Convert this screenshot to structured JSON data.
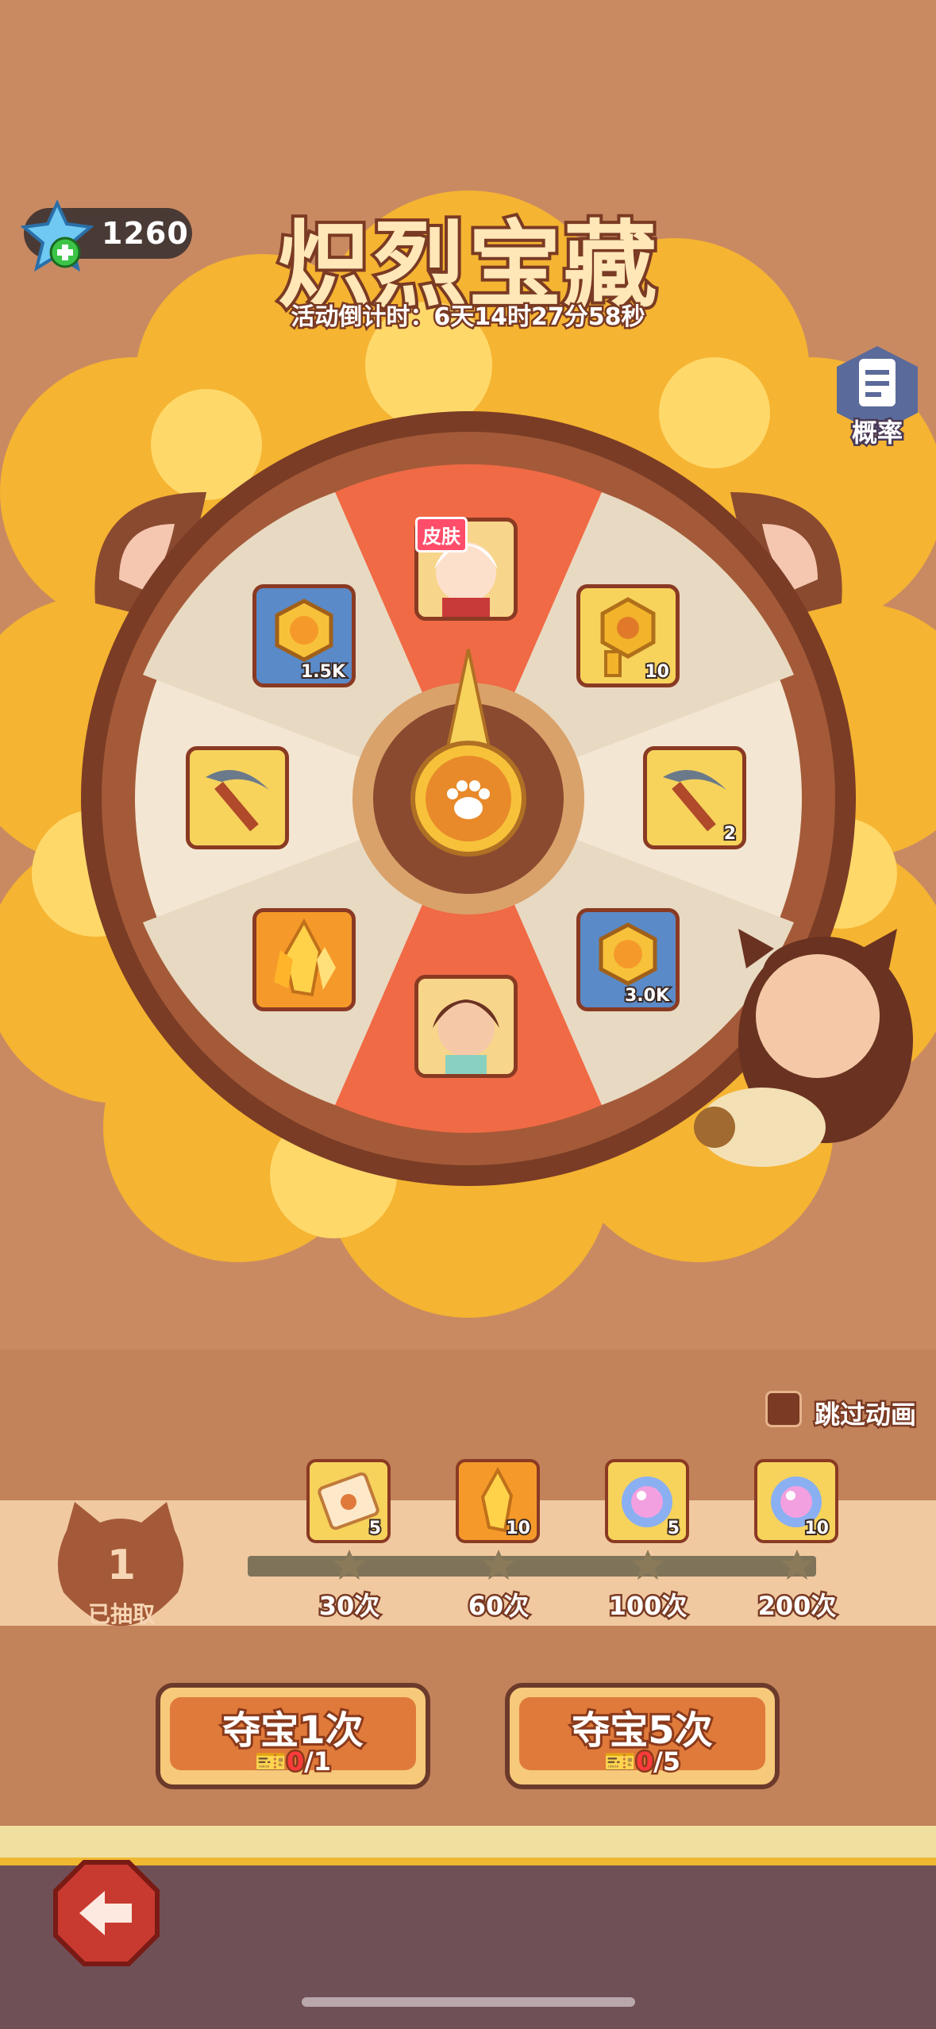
{
  "header": {
    "currency_value": "1260",
    "currency_icon": "blue-gem-plus-icon",
    "title": "炽烈宝藏",
    "countdown": "活动倒计时：6天14时27分58秒",
    "probability_label": "概率"
  },
  "wheel": {
    "center_icon": "paw-icon",
    "items": [
      {
        "name": "skin-character",
        "tag": "皮肤",
        "qty": ""
      },
      {
        "name": "golden-key",
        "qty": "10"
      },
      {
        "name": "pickaxe",
        "qty": "2"
      },
      {
        "name": "gold-coin",
        "qty": "3.0K"
      },
      {
        "name": "character-cat-girl",
        "qty": ""
      },
      {
        "name": "orange-crystal",
        "qty": ""
      },
      {
        "name": "pickaxe",
        "qty": ""
      },
      {
        "name": "gold-coin",
        "qty": "1.5K"
      }
    ]
  },
  "skip_animation_label": "跳过动画",
  "progress": {
    "drawn_count": "1",
    "drawn_label": "已抽取",
    "milestones": [
      {
        "label": "30次",
        "reward": "paw-ticket",
        "qty": "5"
      },
      {
        "label": "60次",
        "reward": "orange-crystal",
        "qty": "10"
      },
      {
        "label": "100次",
        "reward": "pink-pearl",
        "qty": "5"
      },
      {
        "label": "200次",
        "reward": "pink-pearl",
        "qty": "10"
      }
    ]
  },
  "actions": {
    "draw_one": {
      "title": "夺宝1次",
      "cost_have": "0",
      "cost_need": "/1"
    },
    "draw_five": {
      "title": "夺宝5次",
      "cost_have": "0",
      "cost_need": "/5"
    }
  },
  "colors": {
    "accent": "#f0b730",
    "wheel_rim": "#8a4a30",
    "red_wedge": "#f06a45"
  }
}
